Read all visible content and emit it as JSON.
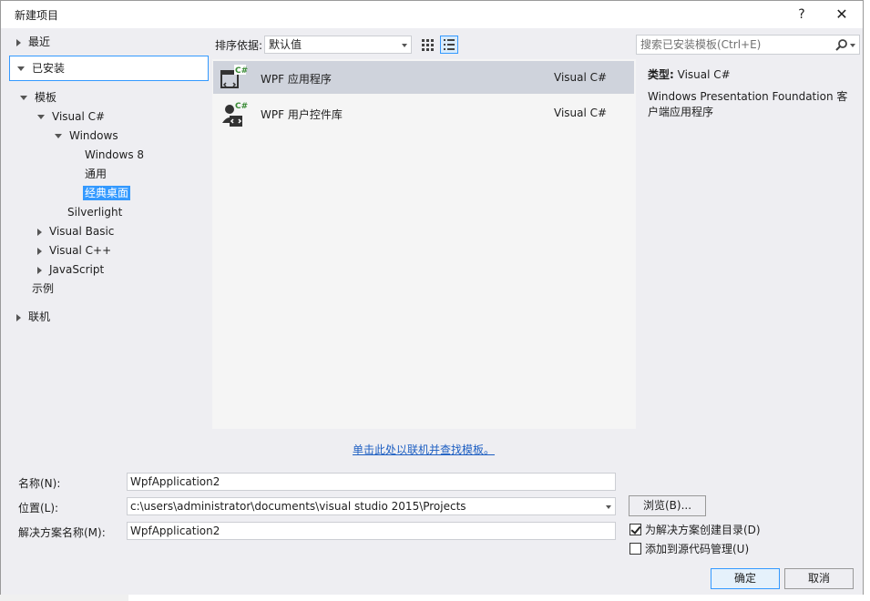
{
  "window": {
    "title": "新建项目",
    "help_glyph": "?",
    "close_glyph": "✕"
  },
  "tree": {
    "recent": "最近",
    "installed": "已安装",
    "templates": "模板",
    "visual_csharp": "Visual C#",
    "windows": "Windows",
    "windows8": "Windows 8",
    "general": "通用",
    "classic_desktop": "经典桌面",
    "silverlight": "Silverlight",
    "visual_basic": "Visual Basic",
    "visual_cpp": "Visual C++",
    "javascript": "JavaScript",
    "samples": "示例",
    "online": "联机"
  },
  "sort": {
    "label": "排序依据:",
    "value": "默认值"
  },
  "templates": [
    {
      "name": "WPF 应用程序",
      "language": "Visual C#",
      "icon": "wpf-app-icon",
      "selected": true
    },
    {
      "name": "WPF 用户控件库",
      "language": "Visual C#",
      "icon": "wpf-user-control-icon",
      "selected": false
    }
  ],
  "online_link": "单击此处以联机并查找模板。",
  "search": {
    "placeholder": "搜索已安装模板(Ctrl+E)"
  },
  "info": {
    "type_key": "类型:",
    "type_value": "Visual C#",
    "description": "Windows Presentation Foundation 客户端应用程序"
  },
  "form": {
    "name_label": "名称(N):",
    "name_value": "WpfApplication2",
    "location_label": "位置(L):",
    "location_value": "c:\\users\\administrator\\documents\\visual studio 2015\\Projects",
    "solution_label": "解决方案名称(M):",
    "solution_value": "WpfApplication2",
    "browse_label": "浏览(B)...",
    "create_dir_label": "为解决方案创建目录(D)",
    "create_dir_checked": true,
    "source_control_label": "添加到源代码管理(U)",
    "source_control_checked": false,
    "ok_label": "确定",
    "cancel_label": "取消"
  },
  "colors": {
    "accent": "#3399ff",
    "selected_row": "#cfd3dc",
    "dialog_bg": "#eeeef2",
    "link": "#1e5fc2"
  }
}
